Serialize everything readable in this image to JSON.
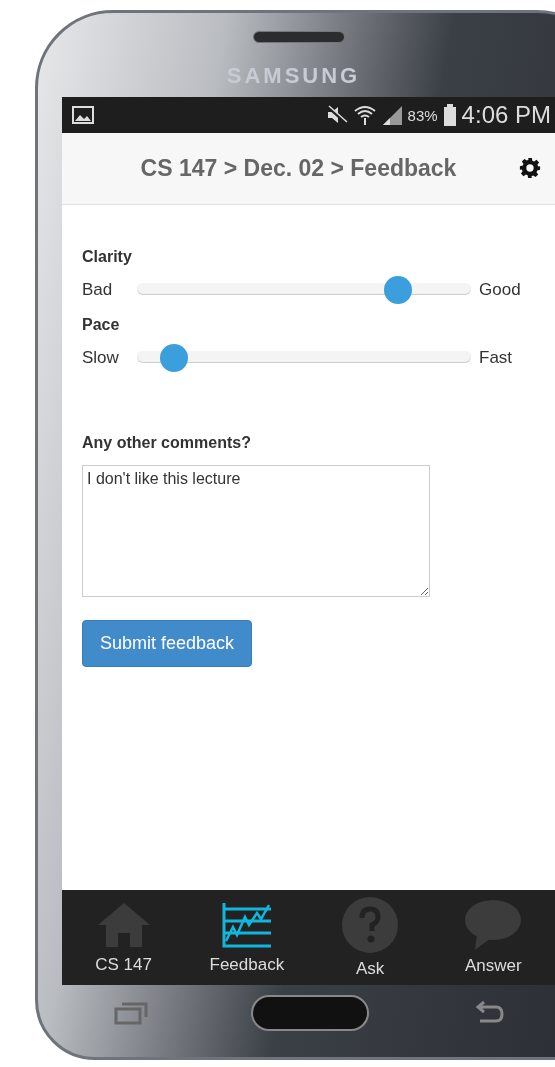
{
  "phone": {
    "brand": "SAMSUNG"
  },
  "status_bar": {
    "battery": "83%",
    "time": "4:06 PM"
  },
  "header": {
    "title": "CS 147 > Dec. 02 > Feedback"
  },
  "sliders": [
    {
      "label": "Clarity",
      "min_label": "Bad",
      "max_label": "Good",
      "level": 0.78
    },
    {
      "label": "Pace",
      "min_label": "Slow",
      "max_label": "Fast",
      "level": 0.11
    }
  ],
  "comments": {
    "label": "Any other comments?",
    "value": "I don't like this lecture"
  },
  "submit": {
    "label": "Submit feedback"
  },
  "tabs": [
    {
      "kind": "home",
      "label": "CS 147",
      "selected": false
    },
    {
      "kind": "chart",
      "label": "Feedback",
      "selected": true
    },
    {
      "kind": "question",
      "label": "Ask",
      "selected": false
    },
    {
      "kind": "bubble",
      "label": "Answer",
      "selected": false
    }
  ]
}
